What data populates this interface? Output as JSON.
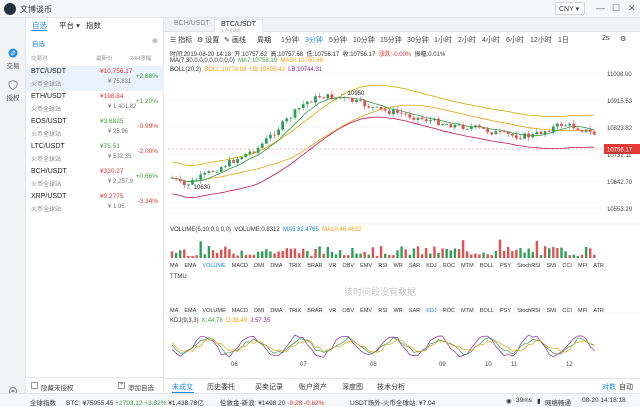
{
  "app": {
    "title": "文博谈币",
    "currency": "CNY"
  },
  "nav": {
    "items": [
      {
        "label": "交易"
      },
      {
        "label": "授权"
      }
    ]
  },
  "panel": {
    "tabs": [
      "自选",
      "平台",
      "指数"
    ],
    "subtab": "自选",
    "columns": [
      "交易对",
      "最新价",
      "24H涨幅"
    ],
    "coins": [
      {
        "symbol": "BTC/USDT",
        "exchange": "火币全球站",
        "price": "¥10,756.17",
        "cny": "¥ 75,831",
        "change": "+2.86%",
        "up": true
      },
      {
        "symbol": "ETH/USDT",
        "exchange": "火币全球站",
        "price": "¥198.84",
        "cny": "¥ 1,401.82",
        "change": "+1.20%",
        "up": true
      },
      {
        "symbol": "EOS/USDT",
        "exchange": "火币全球站",
        "price": "¥3.6825",
        "cny": "¥ 25.96",
        "change": "-0.99%",
        "up": false
      },
      {
        "symbol": "LTC/USDT",
        "exchange": "火币全球站",
        "price": "¥75.51",
        "cny": "¥ 532.35",
        "change": "-2.00%",
        "up": false
      },
      {
        "symbol": "BCH/USDT",
        "exchange": "火币全球站",
        "price": "¥320.27",
        "cny": "¥ 2,257.9",
        "change": "+0.66%",
        "up": true
      },
      {
        "symbol": "XRP/USDT",
        "exchange": "火币全球站",
        "price": "¥0.2775",
        "cny": "¥ 1.96",
        "change": "-3.34%",
        "up": false
      }
    ],
    "footer": {
      "hide_label": "隐藏未授权",
      "add_label": "添加自选"
    }
  },
  "chart_tabs": [
    {
      "label": "BCH/USDT",
      "sub": "火币全球站"
    },
    {
      "label": "BTC/USDT",
      "sub": "火币全球站"
    }
  ],
  "toolbar": {
    "indicator": "指标",
    "settings": "设置",
    "draw": "画线",
    "period": "周期",
    "timeframes": [
      "1分钟",
      "3分钟",
      "5分钟",
      "10分钟",
      "15分钟",
      "30分钟",
      "1小时",
      "2小时",
      "4小时",
      "6小时",
      "12小时",
      "1日"
    ],
    "active_timeframe": "3分钟",
    "mode": "2s"
  },
  "info": {
    "time_label": "时间:2019-08-20 14:18",
    "open_label": "开:10757.62",
    "high_label": "高:10757.68",
    "low_label": "低:10756.17",
    "close_label": "收:10756.17",
    "chg_label": "涨跌:-0.00%",
    "amp_label": "振幅:0.01%",
    "ma_prefix": "MA(7,30,0,0,0,0,0,0,0,0)",
    "ma7": "MA7:10758.19",
    "ma30": "MA30:10780.86",
    "boll_prefix": "BOLL(20,2)",
    "boll": "BOLL:10774.88",
    "ub": "UB:10805.43",
    "lb": "LB:10744.31"
  },
  "chart_data": [
    {
      "type": "candlestick",
      "title": "BTC/USDT",
      "y_ticks": [
        "11008.00",
        "10915.53",
        "10823.82",
        "10732.11",
        "10642.70",
        "10553.29"
      ],
      "ylim": [
        10553.29,
        11008.0
      ],
      "current_price": "10756.17",
      "annotations": {
        "high": "10950",
        "low": "10630"
      },
      "x_ticks": [
        "06",
        "07",
        "08",
        "09",
        "10",
        "11",
        "12"
      ],
      "series": [
        {
          "name": "MA7",
          "color": "#2ea043"
        },
        {
          "name": "MA30",
          "color": "#e8a317"
        },
        {
          "name": "BOLL",
          "color": "#f0a030"
        },
        {
          "name": "UB",
          "color": "#d9a900"
        },
        {
          "name": "LB",
          "color": "#c2185b"
        }
      ]
    },
    {
      "type": "bar",
      "title": "VOLUME(5,10,0,0,0,0)",
      "labels": {
        "volume": "VOLUME:0.8312",
        "ma5": "MA5:32.4765",
        "ma10": "MA10:46.4632"
      }
    },
    {
      "type": "line",
      "title": "KDJ(9,3,3)",
      "labels": {
        "k": "K:44.78",
        "d": "D:38.49",
        "j": "J:57.35"
      }
    }
  ],
  "indicator_rows": [
    "MA",
    "EMA",
    "VOLUME",
    "MACD",
    "DMI",
    "DMA",
    "TRIX",
    "BRAR",
    "VR",
    "OBV",
    "EMV",
    "RSI",
    "WR",
    "SAR",
    "KDJ",
    "ROC",
    "MTM",
    "BOLL",
    "PSY",
    "StochRSI",
    "SMI",
    "CCI",
    "MFI",
    "ATR"
  ],
  "indicator_active_row1": "VOLUME",
  "indicator_active_row2": "KDJ",
  "ttmu_label": "TTMU",
  "no_data": "该时间段没有数据",
  "bottom_tabs": [
    "未成交",
    "历史委托",
    "买卖记录",
    "账户资产",
    "深度图",
    "技术分析"
  ],
  "bottom_right": "对数",
  "bottom_right2": "自动",
  "status": {
    "market": "全球指数",
    "btc_label": "BTC:",
    "btc_value": "¥75955.45",
    "btc_change": "+2793.12 +3.82%",
    "btc_vol": "¥1,438.78亿",
    "lunshu_label": "伦敦金-新浪:",
    "lunshu_value": "¥1498.20",
    "lunshu_change": "-9.28 -0.62%",
    "usdt_label": "USDT场外-火币全球站:",
    "usdt_value": "¥7.04",
    "latency": "39ms",
    "network": "网络畅通",
    "time": "08-20 14:18:18"
  }
}
